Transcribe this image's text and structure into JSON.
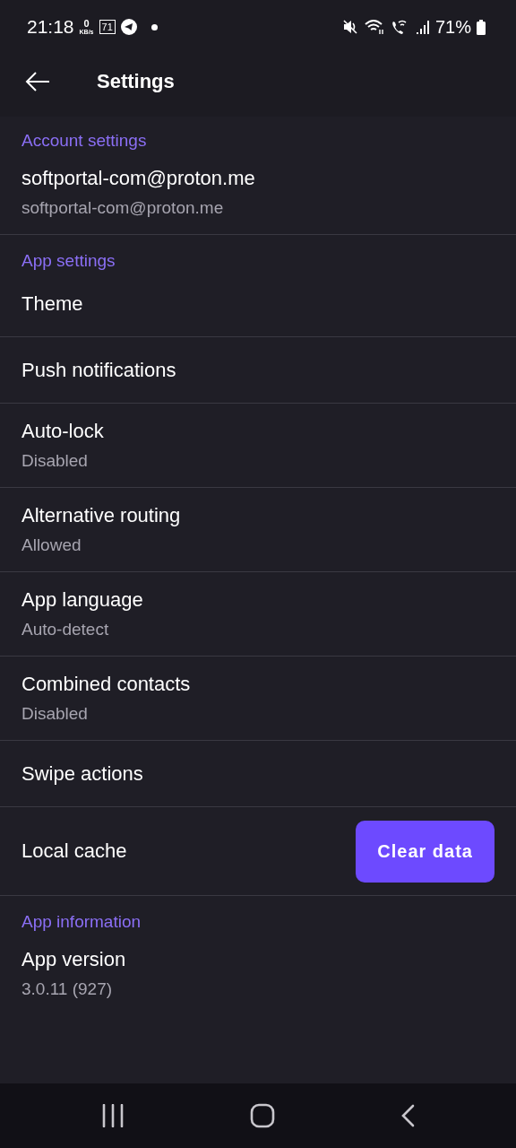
{
  "status_bar": {
    "time": "21:18",
    "speed_value": "0",
    "speed_unit": "KB/s",
    "badge": "71",
    "battery": "71%"
  },
  "top_bar": {
    "title": "Settings"
  },
  "sections": [
    {
      "header": "Account settings",
      "items": [
        {
          "title": "softportal-com@proton.me",
          "subtitle": "softportal-com@proton.me"
        }
      ]
    },
    {
      "header": "App settings",
      "items": [
        {
          "title": "Theme"
        },
        {
          "title": "Push notifications"
        },
        {
          "title": "Auto-lock",
          "subtitle": "Disabled"
        },
        {
          "title": "Alternative routing",
          "subtitle": "Allowed"
        },
        {
          "title": "App language",
          "subtitle": "Auto-detect"
        },
        {
          "title": "Combined contacts",
          "subtitle": "Disabled"
        },
        {
          "title": "Swipe actions"
        },
        {
          "title": "Local cache",
          "button": "Clear data"
        }
      ]
    },
    {
      "header": "App information",
      "items": [
        {
          "title": "App version",
          "subtitle": "3.0.11 (927)"
        }
      ]
    }
  ]
}
